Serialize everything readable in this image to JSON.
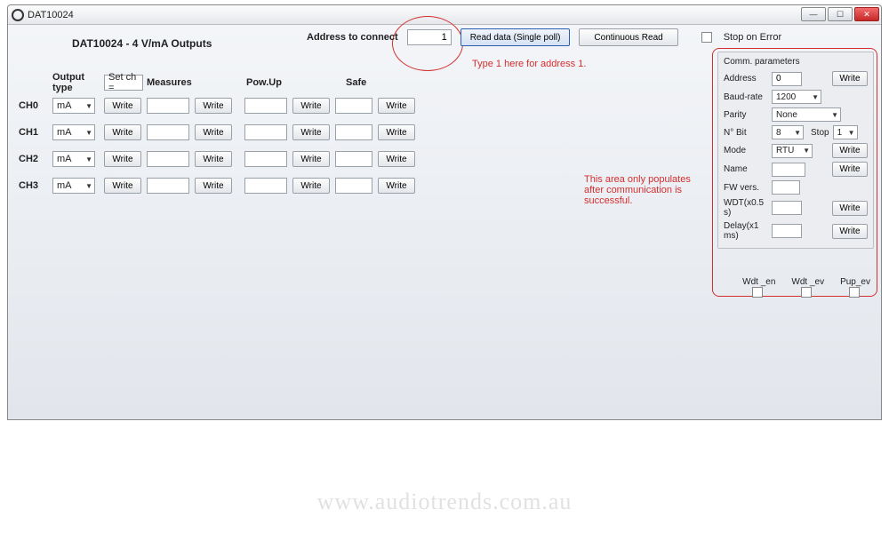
{
  "window": {
    "title": "DAT10024"
  },
  "subtitle": "DAT10024 - 4 V/mA Outputs",
  "top": {
    "address_label": "Address to connect",
    "address_value": "1",
    "read_single": "Read data (Single poll)",
    "continuous": "Continuous Read",
    "stop_on_error": "Stop on Error"
  },
  "table": {
    "hdr_output_type": "Output type",
    "hdr_set_ch": "Set ch =",
    "hdr_measures": "Measures",
    "hdr_powup": "Pow.Up",
    "hdr_safe": "Safe",
    "write": "Write",
    "rows": [
      {
        "ch": "CH0",
        "otype": "mA"
      },
      {
        "ch": "CH1",
        "otype": "mA"
      },
      {
        "ch": "CH2",
        "otype": "mA"
      },
      {
        "ch": "CH3",
        "otype": "mA"
      }
    ]
  },
  "comm": {
    "legend": "Comm. parameters",
    "address_l": "Address",
    "address_v": "0",
    "baud_l": "Baud-rate",
    "baud_v": "1200",
    "parity_l": "Parity",
    "parity_v": "None",
    "nbit_l": "N° Bit",
    "nbit_v": "8",
    "stop_l": "Stop",
    "stop_v": "1",
    "mode_l": "Mode",
    "mode_v": "RTU",
    "name_l": "Name",
    "name_v": "",
    "fw_l": "FW vers.",
    "fw_v": "",
    "wdt_l": "WDT(x0.5 s)",
    "wdt_v": "",
    "delay_l": "Delay(x1 ms)",
    "delay_v": "",
    "write": "Write"
  },
  "bottom": {
    "wdt_en": "Wdt _en",
    "wdt_ev": "Wdt _ev",
    "pup_ev": "Pup_ev"
  },
  "annot": {
    "addr_hint": "Type 1 here for address 1.",
    "comm_hint": "This area only populates after communication is successful."
  },
  "watermark": "www.audiotrends.com.au"
}
